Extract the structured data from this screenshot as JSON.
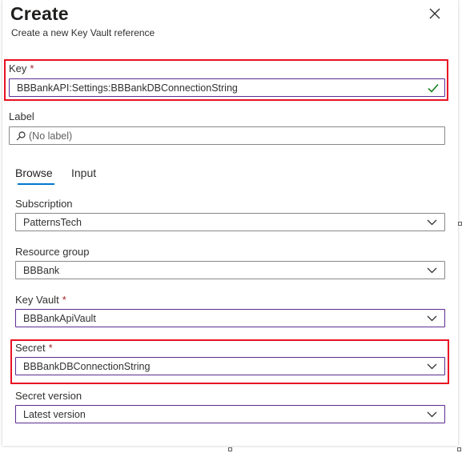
{
  "header": {
    "title": "Create",
    "subtitle": "Create a new Key Vault reference"
  },
  "key": {
    "label": "Key",
    "required_mark": "*",
    "value": "BBBankAPI:Settings:BBBankDBConnectionString",
    "valid": true
  },
  "label_field": {
    "label": "Label",
    "placeholder": "(No label)"
  },
  "tabs": [
    {
      "label": "Browse",
      "active": true
    },
    {
      "label": "Input",
      "active": false
    }
  ],
  "subscription": {
    "label": "Subscription",
    "value": "PatternsTech"
  },
  "resource_group": {
    "label": "Resource group",
    "value": "BBBank"
  },
  "key_vault": {
    "label": "Key Vault",
    "required_mark": "*",
    "value": "BBBankApiVault"
  },
  "secret": {
    "label": "Secret",
    "required_mark": "*",
    "value": "BBBankDBConnectionString"
  },
  "secret_version": {
    "label": "Secret version",
    "value": "Latest version"
  },
  "colors": {
    "focus_border": "#5c2d91",
    "highlight": "#e81123",
    "tab_underline": "#0078d4",
    "valid_check": "#107c10",
    "required": "#a4262c"
  }
}
